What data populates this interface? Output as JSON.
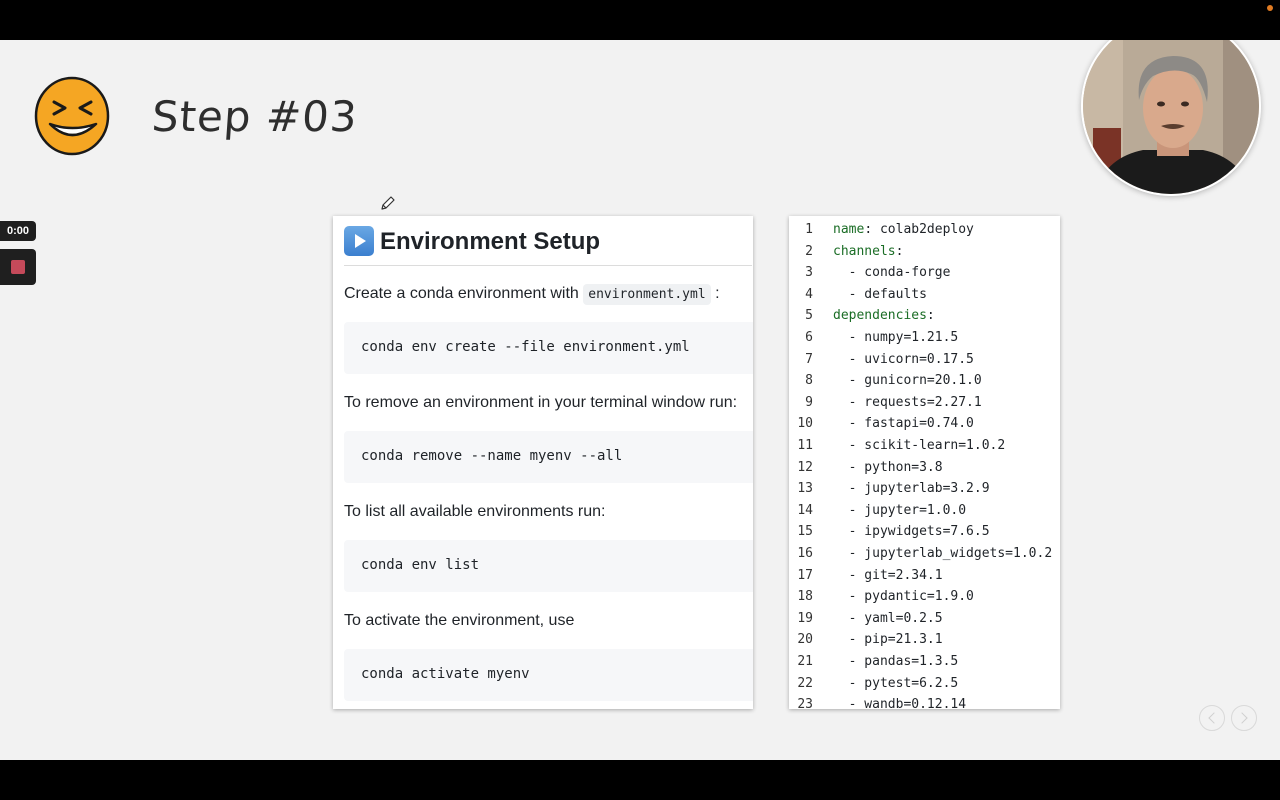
{
  "recorder": {
    "timer": "0:00"
  },
  "slide": {
    "title": "Step #03"
  },
  "doc": {
    "title": "Environment Setup",
    "sections": [
      {
        "text": "Create a conda environment with ",
        "inline_code": "environment.yml",
        "suffix": " :",
        "code": "conda env create --file environment.yml"
      },
      {
        "text": "To remove an environment in your terminal window run:",
        "code": "conda remove --name myenv --all"
      },
      {
        "text": "To list all available environments run:",
        "code": "conda env list"
      },
      {
        "text": "To activate the environment, use",
        "code": "conda activate myenv"
      }
    ]
  },
  "yaml": {
    "lines": [
      {
        "n": "1",
        "key": "name",
        "sep": ": ",
        "val": "colab2deploy"
      },
      {
        "n": "2",
        "key": "channels",
        "sep": ":",
        "val": ""
      },
      {
        "n": "3",
        "val": "  - conda-forge"
      },
      {
        "n": "4",
        "val": "  - defaults"
      },
      {
        "n": "5",
        "key": "dependencies",
        "sep": ":",
        "val": ""
      },
      {
        "n": "6",
        "val": "  - numpy=1.21.5"
      },
      {
        "n": "7",
        "val": "  - uvicorn=0.17.5"
      },
      {
        "n": "8",
        "val": "  - gunicorn=20.1.0"
      },
      {
        "n": "9",
        "val": "  - requests=2.27.1"
      },
      {
        "n": "10",
        "val": "  - fastapi=0.74.0"
      },
      {
        "n": "11",
        "val": "  - scikit-learn=1.0.2"
      },
      {
        "n": "12",
        "val": "  - python=3.8"
      },
      {
        "n": "13",
        "val": "  - jupyterlab=3.2.9"
      },
      {
        "n": "14",
        "val": "  - jupyter=1.0.0"
      },
      {
        "n": "15",
        "val": "  - ipywidgets=7.6.5"
      },
      {
        "n": "16",
        "val": "  - jupyterlab_widgets=1.0.2"
      },
      {
        "n": "17",
        "val": "  - git=2.34.1"
      },
      {
        "n": "18",
        "val": "  - pydantic=1.9.0"
      },
      {
        "n": "19",
        "val": "  - yaml=0.2.5"
      },
      {
        "n": "20",
        "val": "  - pip=21.3.1"
      },
      {
        "n": "21",
        "val": "  - pandas=1.3.5"
      },
      {
        "n": "22",
        "val": "  - pytest=6.2.5"
      },
      {
        "n": "23",
        "val": "  - wandb=0.12.14"
      }
    ]
  },
  "icons": {
    "emoji": "grinning-squinting-face-icon",
    "play": "play-button-icon",
    "pencil": "pencil-cursor-icon",
    "record": "stop-record-icon",
    "prev": "chevron-left-icon",
    "next": "chevron-right-icon"
  },
  "colors": {
    "accent": "#3b7fcf",
    "yaml_key": "#1b6d26",
    "record": "#c54a5a",
    "emoji": "#f5a623"
  }
}
